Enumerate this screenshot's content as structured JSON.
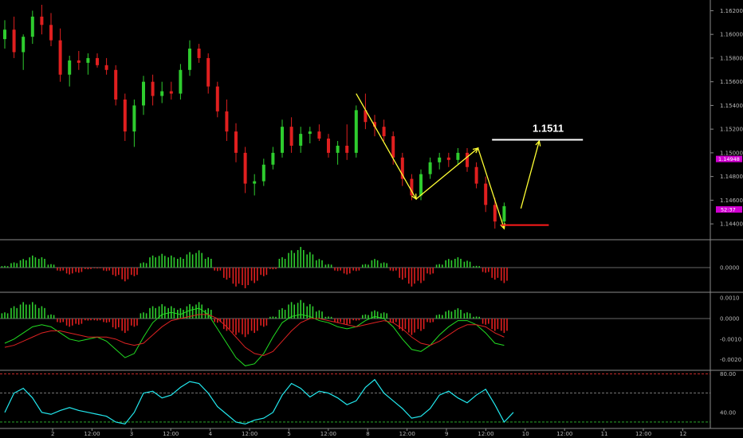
{
  "chart_data": [
    {
      "type": "candlestick",
      "instrument_scale": "price",
      "y_ticks": [
        "1.16200",
        "1.16000",
        "1.15800",
        "1.15600",
        "1.15400",
        "1.15200",
        "1.15000",
        "1.14800",
        "1.14600",
        "1.14400"
      ],
      "ylim": [
        1.143,
        1.1625
      ],
      "current_price_label": "1.14948",
      "countdown_label": "52:37",
      "annotation_label": "1.1511",
      "colors": {
        "up": "#2ecc2e",
        "down": "#e01f1f",
        "zigzag": "#ffff33",
        "target_line": "#ffffff",
        "support_line": "#ff1a1a",
        "price_tag": "#d000d0"
      },
      "annotation_level": 1.1511,
      "support_level": 1.1439,
      "ohlc": [
        [
          1.1596,
          1.1612,
          1.1588,
          1.1604
        ],
        [
          1.1604,
          1.1615,
          1.158,
          1.1585
        ],
        [
          1.1585,
          1.16,
          1.157,
          1.1598
        ],
        [
          1.1598,
          1.162,
          1.1592,
          1.1615
        ],
        [
          1.1615,
          1.1625,
          1.16,
          1.1608
        ],
        [
          1.1608,
          1.1618,
          1.159,
          1.1595
        ],
        [
          1.1595,
          1.1605,
          1.156,
          1.1566
        ],
        [
          1.1566,
          1.1582,
          1.1556,
          1.1578
        ],
        [
          1.1578,
          1.1586,
          1.157,
          1.1576
        ],
        [
          1.1576,
          1.1584,
          1.1566,
          1.158
        ],
        [
          1.158,
          1.1584,
          1.1572,
          1.1574
        ],
        [
          1.1574,
          1.158,
          1.1566,
          1.157
        ],
        [
          1.157,
          1.1574,
          1.154,
          1.1545
        ],
        [
          1.1545,
          1.155,
          1.151,
          1.1518
        ],
        [
          1.1518,
          1.1545,
          1.1505,
          1.154
        ],
        [
          1.154,
          1.1565,
          1.1532,
          1.156
        ],
        [
          1.156,
          1.1566,
          1.154,
          1.1548
        ],
        [
          1.1548,
          1.156,
          1.1542,
          1.1552
        ],
        [
          1.1552,
          1.156,
          1.1545,
          1.155
        ],
        [
          1.155,
          1.1575,
          1.1545,
          1.157
        ],
        [
          1.157,
          1.1595,
          1.1565,
          1.1588
        ],
        [
          1.1588,
          1.1592,
          1.1576,
          1.158
        ],
        [
          1.158,
          1.1584,
          1.155,
          1.1556
        ],
        [
          1.1556,
          1.156,
          1.153,
          1.1535
        ],
        [
          1.1535,
          1.1545,
          1.151,
          1.1518
        ],
        [
          1.1518,
          1.1525,
          1.1492,
          1.15
        ],
        [
          1.15,
          1.1505,
          1.1466,
          1.1474
        ],
        [
          1.1474,
          1.1482,
          1.1464,
          1.1476
        ],
        [
          1.1476,
          1.1495,
          1.1472,
          1.149
        ],
        [
          1.149,
          1.1505,
          1.1486,
          1.15
        ],
        [
          1.15,
          1.1528,
          1.1496,
          1.1522
        ],
        [
          1.1522,
          1.153,
          1.15,
          1.1506
        ],
        [
          1.1506,
          1.1522,
          1.15,
          1.1516
        ],
        [
          1.1516,
          1.1522,
          1.1508,
          1.1518
        ],
        [
          1.1518,
          1.1524,
          1.151,
          1.1512
        ],
        [
          1.1512,
          1.1516,
          1.1496,
          1.15
        ],
        [
          1.15,
          1.151,
          1.149,
          1.1506
        ],
        [
          1.1506,
          1.1524,
          1.1494,
          1.15
        ],
        [
          1.15,
          1.154,
          1.1496,
          1.1536
        ],
        [
          1.1536,
          1.155,
          1.152,
          1.1526
        ],
        [
          1.1526,
          1.1532,
          1.1514,
          1.1522
        ],
        [
          1.1522,
          1.1528,
          1.151,
          1.1514
        ],
        [
          1.1514,
          1.1518,
          1.149,
          1.1496
        ],
        [
          1.1496,
          1.15,
          1.1472,
          1.1478
        ],
        [
          1.1478,
          1.1482,
          1.146,
          1.1464
        ],
        [
          1.1464,
          1.1486,
          1.146,
          1.1482
        ],
        [
          1.1482,
          1.1496,
          1.1478,
          1.1492
        ],
        [
          1.1492,
          1.15,
          1.1486,
          1.1496
        ],
        [
          1.1496,
          1.15,
          1.1488,
          1.1494
        ],
        [
          1.1494,
          1.1504,
          1.149,
          1.15
        ],
        [
          1.15,
          1.1504,
          1.1484,
          1.1488
        ],
        [
          1.1488,
          1.1492,
          1.147,
          1.1474
        ],
        [
          1.1474,
          1.148,
          1.145,
          1.1456
        ],
        [
          1.1456,
          1.1462,
          1.1436,
          1.1442
        ],
        [
          1.1442,
          1.1458,
          1.1438,
          1.1455
        ]
      ]
    },
    {
      "type": "bar",
      "indicator": "histogram-oscillator",
      "y_ticks": [
        "0.0000"
      ],
      "ylim": [
        -0.0025,
        0.0025
      ],
      "values": [
        0.0002,
        0.0006,
        0.001,
        0.0014,
        0.0012,
        0.0004,
        -0.0004,
        -0.0008,
        -0.0006,
        -0.0002,
        -0.0001,
        -0.0004,
        -0.001,
        -0.0016,
        -0.001,
        0.0006,
        0.0014,
        0.0016,
        0.0014,
        0.0012,
        0.0018,
        0.002,
        0.0012,
        -0.0004,
        -0.0014,
        -0.0022,
        -0.0024,
        -0.0018,
        -0.001,
        -0.0002,
        0.0012,
        0.002,
        0.0024,
        0.0018,
        0.001,
        0.0004,
        -0.0004,
        -0.0008,
        -0.0004,
        0.0004,
        0.001,
        0.0006,
        -0.0004,
        -0.0014,
        -0.0022,
        -0.0018,
        -0.0008,
        0.0004,
        0.001,
        0.0012,
        0.0008,
        0.0002,
        -0.0006,
        -0.0014,
        -0.0018
      ]
    },
    {
      "type": "bar",
      "indicator": "macd",
      "y_ticks": [
        "0.0010",
        "0.0000",
        "-0.0010",
        "-0.0020"
      ],
      "ylim": [
        -0.0024,
        0.0012
      ],
      "histogram": [
        0.0003,
        0.0006,
        0.0008,
        0.0008,
        0.0006,
        0.0002,
        -0.0002,
        -0.0004,
        -0.0003,
        -0.0001,
        -0.0001,
        -0.0002,
        -0.0005,
        -0.0007,
        -0.0004,
        0.0003,
        0.0006,
        0.0007,
        0.0006,
        0.0005,
        0.0007,
        0.0008,
        0.0005,
        -0.0002,
        -0.0006,
        -0.0008,
        -0.0009,
        -0.0007,
        -0.0004,
        0.0001,
        0.0005,
        0.0008,
        0.0009,
        0.0007,
        0.0004,
        0.0001,
        -0.0002,
        -0.0003,
        -0.0001,
        0.0002,
        0.0004,
        0.0003,
        -0.0002,
        -0.0006,
        -0.0008,
        -0.0006,
        -0.0002,
        0.0002,
        0.0004,
        0.0005,
        0.0003,
        0.0001,
        -0.0003,
        -0.0006,
        -0.0007
      ],
      "series": [
        {
          "color": "#22dd22",
          "values": [
            -0.0012,
            -0.001,
            -0.0007,
            -0.0004,
            -0.0003,
            -0.0004,
            -0.0007,
            -0.001,
            -0.0011,
            -0.001,
            -0.0009,
            -0.0011,
            -0.0015,
            -0.0019,
            -0.0017,
            -0.0009,
            -0.0002,
            0.0002,
            0.0003,
            0.0002,
            0.0004,
            0.0005,
            0.0002,
            -0.0005,
            -0.0012,
            -0.0019,
            -0.0023,
            -0.0022,
            -0.0017,
            -0.0009,
            -0.0002,
            0.0001,
            0.0002,
            0.0001,
            -0.0001,
            -0.0002,
            -0.0004,
            -0.0005,
            -0.0004,
            -0.0001,
            0.0001,
            0.0,
            -0.0004,
            -0.001,
            -0.0015,
            -0.0016,
            -0.0013,
            -0.0008,
            -0.0004,
            -0.0001,
            -0.0001,
            -0.0003,
            -0.0007,
            -0.0012,
            -0.0013
          ]
        },
        {
          "color": "#dd2222",
          "values": [
            -0.0014,
            -0.0013,
            -0.0011,
            -0.0009,
            -0.0007,
            -0.0006,
            -0.0006,
            -0.0007,
            -0.0008,
            -0.0009,
            -0.0009,
            -0.0009,
            -0.001,
            -0.0012,
            -0.0013,
            -0.0012,
            -0.0008,
            -0.0004,
            -0.0001,
            0.0,
            0.0001,
            0.0002,
            0.0002,
            0.0,
            -0.0004,
            -0.0009,
            -0.0014,
            -0.0017,
            -0.0018,
            -0.0016,
            -0.0011,
            -0.0006,
            -0.0002,
            0.0,
            0.0,
            -0.0001,
            -0.0002,
            -0.0003,
            -0.0004,
            -0.0003,
            -0.0002,
            -0.0001,
            -0.0002,
            -0.0005,
            -0.0009,
            -0.0012,
            -0.0013,
            -0.0011,
            -0.0008,
            -0.0005,
            -0.0003,
            -0.0003,
            -0.0004,
            -0.0007,
            -0.0009
          ]
        }
      ]
    },
    {
      "type": "line",
      "indicator": "oscillator",
      "y_ticks": [
        "80.00",
        "40.00"
      ],
      "ylim": [
        25,
        82
      ],
      "levels": [
        80,
        60,
        30
      ],
      "series": [
        {
          "color": "#22e8ee",
          "values": [
            40,
            60,
            65,
            55,
            40,
            38,
            42,
            45,
            42,
            40,
            38,
            36,
            30,
            28,
            40,
            60,
            62,
            55,
            58,
            66,
            72,
            70,
            60,
            46,
            38,
            30,
            28,
            32,
            34,
            40,
            58,
            70,
            65,
            56,
            62,
            60,
            55,
            48,
            52,
            66,
            74,
            60,
            52,
            44,
            34,
            36,
            44,
            58,
            62,
            55,
            50,
            58,
            64,
            48,
            30,
            40
          ]
        }
      ]
    }
  ],
  "x_ticks": [
    "2",
    "12:00",
    "3",
    "12:00",
    "4",
    "12:00",
    "5",
    "12:00",
    "8",
    "12:00",
    "9",
    "12:00",
    "10",
    "12:00",
    "11",
    "12:00",
    "12"
  ]
}
